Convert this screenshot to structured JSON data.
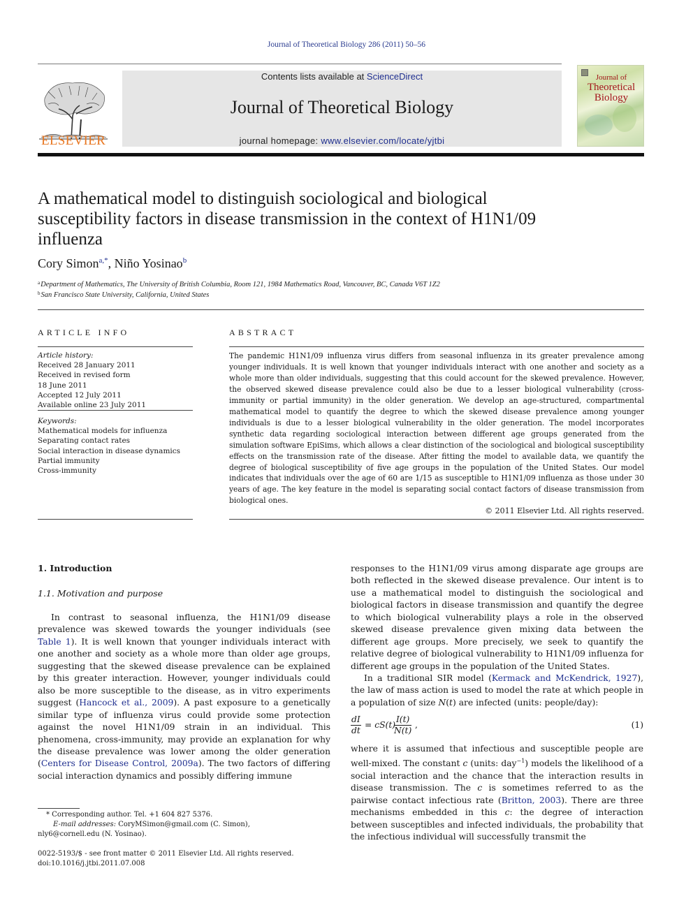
{
  "running_head": "Journal of Theoretical Biology 286 (2011) 50–56",
  "masthead": {
    "publisher_logo": "ELSEVIER",
    "contents_prefix": "Contents lists available at ",
    "contents_link": "ScienceDirect",
    "journal_title": "Journal of Theoretical Biology",
    "homepage_prefix": "journal homepage: ",
    "homepage_link": "www.elsevier.com/locate/yjtbi",
    "cover": {
      "line1": "Journal of",
      "line2": "Theoretical",
      "line3": "Biology"
    }
  },
  "article": {
    "title": "A mathematical model to distinguish sociological and biological susceptibility factors in disease transmission in the context of H1N1/09 influenza",
    "authors": [
      {
        "name": "Cory Simon",
        "marks": "a,*"
      },
      {
        "name": "Niño Yosinao",
        "marks": "b"
      }
    ],
    "author_separator": ", ",
    "affiliations": [
      {
        "mark": "a",
        "text": "Department of Mathematics, The University of British Columbia, Room 121, 1984 Mathematics Road, Vancouver, BC, Canada V6T 1Z2"
      },
      {
        "mark": "b",
        "text": "San Francisco State University, California, United States"
      }
    ]
  },
  "article_info": {
    "heading": "ARTICLE INFO",
    "history_label": "Article history:",
    "history": [
      "Received 28 January 2011",
      "Received in revised form",
      "18 June 2011",
      "Accepted 12 July 2011",
      "Available online 23 July 2011"
    ],
    "keywords_label": "Keywords:",
    "keywords": [
      "Mathematical models for influenza",
      "Separating contact rates",
      "Social interaction in disease dynamics",
      "Partial immunity",
      "Cross-immunity"
    ]
  },
  "abstract": {
    "heading": "ABSTRACT",
    "text": "The pandemic H1N1/09 influenza virus differs from seasonal influenza in its greater prevalence among younger individuals. It is well known that younger individuals interact with one another and society as a whole more than older individuals, suggesting that this could account for the skewed prevalence. However, the observed skewed disease prevalence could also be due to a lesser biological vulnerability (cross-immunity or partial immunity) in the older generation. We develop an age-structured, compartmental mathematical model to quantify the degree to which the skewed disease prevalence among younger individuals is due to a lesser biological vulnerability in the older generation. The model incorporates synthetic data regarding sociological interaction between different age groups generated from the simulation software EpiSims, which allows a clear distinction of the sociological and biological susceptibility effects on the transmission rate of the disease. After fitting the model to available data, we quantify the degree of biological susceptibility of five age groups in the population of the United States. Our model indicates that individuals over the age of 60 are 1/15 as susceptible to H1N1/09 influenza as those under 30 years of age. The key feature in the model is separating social contact factors of disease transmission from biological ones.",
    "copyright": "© 2011 Elsevier Ltd. All rights reserved."
  },
  "body": {
    "section_heading": "1.  Introduction",
    "subsection_heading": "1.1.  Motivation and purpose",
    "left_para": {
      "t1": "In contrast to seasonal influenza, the H1N1/09 disease prevalence was skewed towards the younger individuals (see ",
      "link1": "Table 1",
      "t2": "). It is well known that younger individuals interact with one another and society as a whole more than older age groups, suggesting that the skewed disease prevalence can be explained by this greater interaction. However, younger individuals could also be more susceptible to the disease, as in vitro experiments suggest (",
      "link2": "Hancock et al., 2009",
      "t3": "). A past exposure to a genetically similar type of influenza virus could provide some protection against the novel H1N1/09 strain in an individual. This phenomena, cross-immunity, may provide an explanation for why the disease prevalence was lower among the older generation (",
      "link3": "Centers for Disease Control, 2009a",
      "t4": "). The two factors of differing social interaction dynamics and possibly differing immune"
    },
    "right_para1": "responses to the H1N1/09 virus among disparate age groups are both reflected in the skewed disease prevalence. Our intent is to use a mathematical model to distinguish the sociological and biological factors in disease transmission and quantify the degree to which biological vulnerability plays a role in the observed skewed disease prevalence given mixing data between the different age groups. More precisely, we seek to quantify the relative degree of biological vulnerability to H1N1/09 influenza for different age groups in the population of the United States.",
    "right_para2": {
      "t1": "In a traditional SIR model (",
      "link1": "Kermack and McKendrick, 1927",
      "t2": "), the law of mass action is used to model the rate at which people in a population of size ",
      "var_N": "N",
      "t3": "(",
      "var_t": "t",
      "t4": ") are infected (units: people/day):"
    },
    "equation": {
      "lhs_num": "dI",
      "lhs_den": "dt",
      "middle": "= cS(t)",
      "rhs_num": "I(t)",
      "rhs_den": "N(t)",
      "trail": ",",
      "number": "(1)"
    },
    "right_para3": {
      "t1": "where it is assumed that infectious and susceptible people are well-mixed. The constant ",
      "var_c1": "c",
      "t2": " (units: day",
      "sup": "−1",
      "t3": ") models the likelihood of a social interaction and the chance that the interaction results in disease transmission. The ",
      "var_c2": "c",
      "t4": " is sometimes referred to as the pairwise contact infectious rate (",
      "link1": "Britton, 2003",
      "t5": "). There are three mechanisms embedded in this ",
      "var_c3": "c",
      "t6": ": the degree of interaction between susceptibles and infected individuals, the probability that the infectious individual will successfully transmit the"
    }
  },
  "footnotes": {
    "corresponding": "* Corresponding author. Tel. +1 604 827 5376.",
    "email_label": "E-mail addresses:",
    "email1": " CoryMSimon@gmail.com (C. Simon),",
    "email2": "nly6@cornell.edu (N. Yosinao).",
    "issn_line": "0022-5193/$ - see front matter © 2011 Elsevier Ltd. All rights reserved.",
    "doi_line": "doi:10.1016/j.jtbi.2011.07.008"
  },
  "colors": {
    "link": "#1f2f8f",
    "elsevier_orange": "#e87722",
    "cover_title_red": "#a3161a",
    "masthead_gray": "#e6e6e6"
  }
}
